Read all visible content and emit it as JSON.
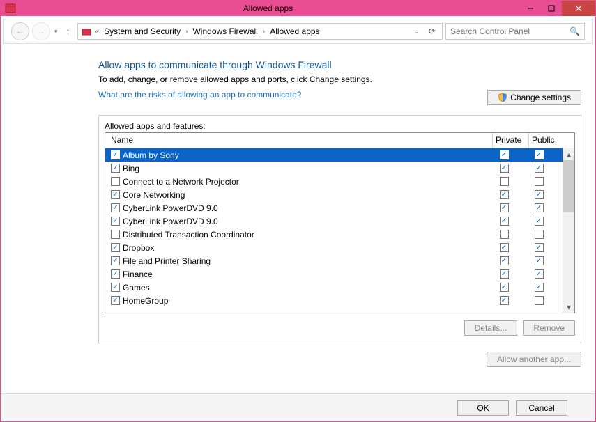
{
  "window_title": "Allowed apps",
  "breadcrumb": [
    "System and Security",
    "Windows Firewall",
    "Allowed apps"
  ],
  "search_placeholder": "Search Control Panel",
  "heading": "Allow apps to communicate through Windows Firewall",
  "desc": "To add, change, or remove allowed apps and ports, click Change settings.",
  "risks_link": "What are the risks of allowing an app to communicate?",
  "change_settings": "Change settings",
  "legend_title": "Allowed apps and features:",
  "col_name": "Name",
  "col_private": "Private",
  "col_public": "Public",
  "rows": [
    {
      "enabled": true,
      "name": "Album by Sony",
      "private": true,
      "public": true,
      "selected": true
    },
    {
      "enabled": true,
      "name": "Bing",
      "private": true,
      "public": true
    },
    {
      "enabled": false,
      "name": "Connect to a Network Projector",
      "private": false,
      "public": false
    },
    {
      "enabled": true,
      "name": "Core Networking",
      "private": true,
      "public": true
    },
    {
      "enabled": true,
      "name": "CyberLink PowerDVD 9.0",
      "private": true,
      "public": true
    },
    {
      "enabled": true,
      "name": "CyberLink PowerDVD 9.0",
      "private": true,
      "public": true
    },
    {
      "enabled": false,
      "name": "Distributed Transaction Coordinator",
      "private": false,
      "public": false
    },
    {
      "enabled": true,
      "name": "Dropbox",
      "private": true,
      "public": true
    },
    {
      "enabled": true,
      "name": "File and Printer Sharing",
      "private": true,
      "public": true
    },
    {
      "enabled": true,
      "name": "Finance",
      "private": true,
      "public": true
    },
    {
      "enabled": true,
      "name": "Games",
      "private": true,
      "public": true
    },
    {
      "enabled": true,
      "name": "HomeGroup",
      "private": true,
      "public": false
    }
  ],
  "details_btn": "Details...",
  "remove_btn": "Remove",
  "allow_another": "Allow another app...",
  "ok": "OK",
  "cancel": "Cancel"
}
